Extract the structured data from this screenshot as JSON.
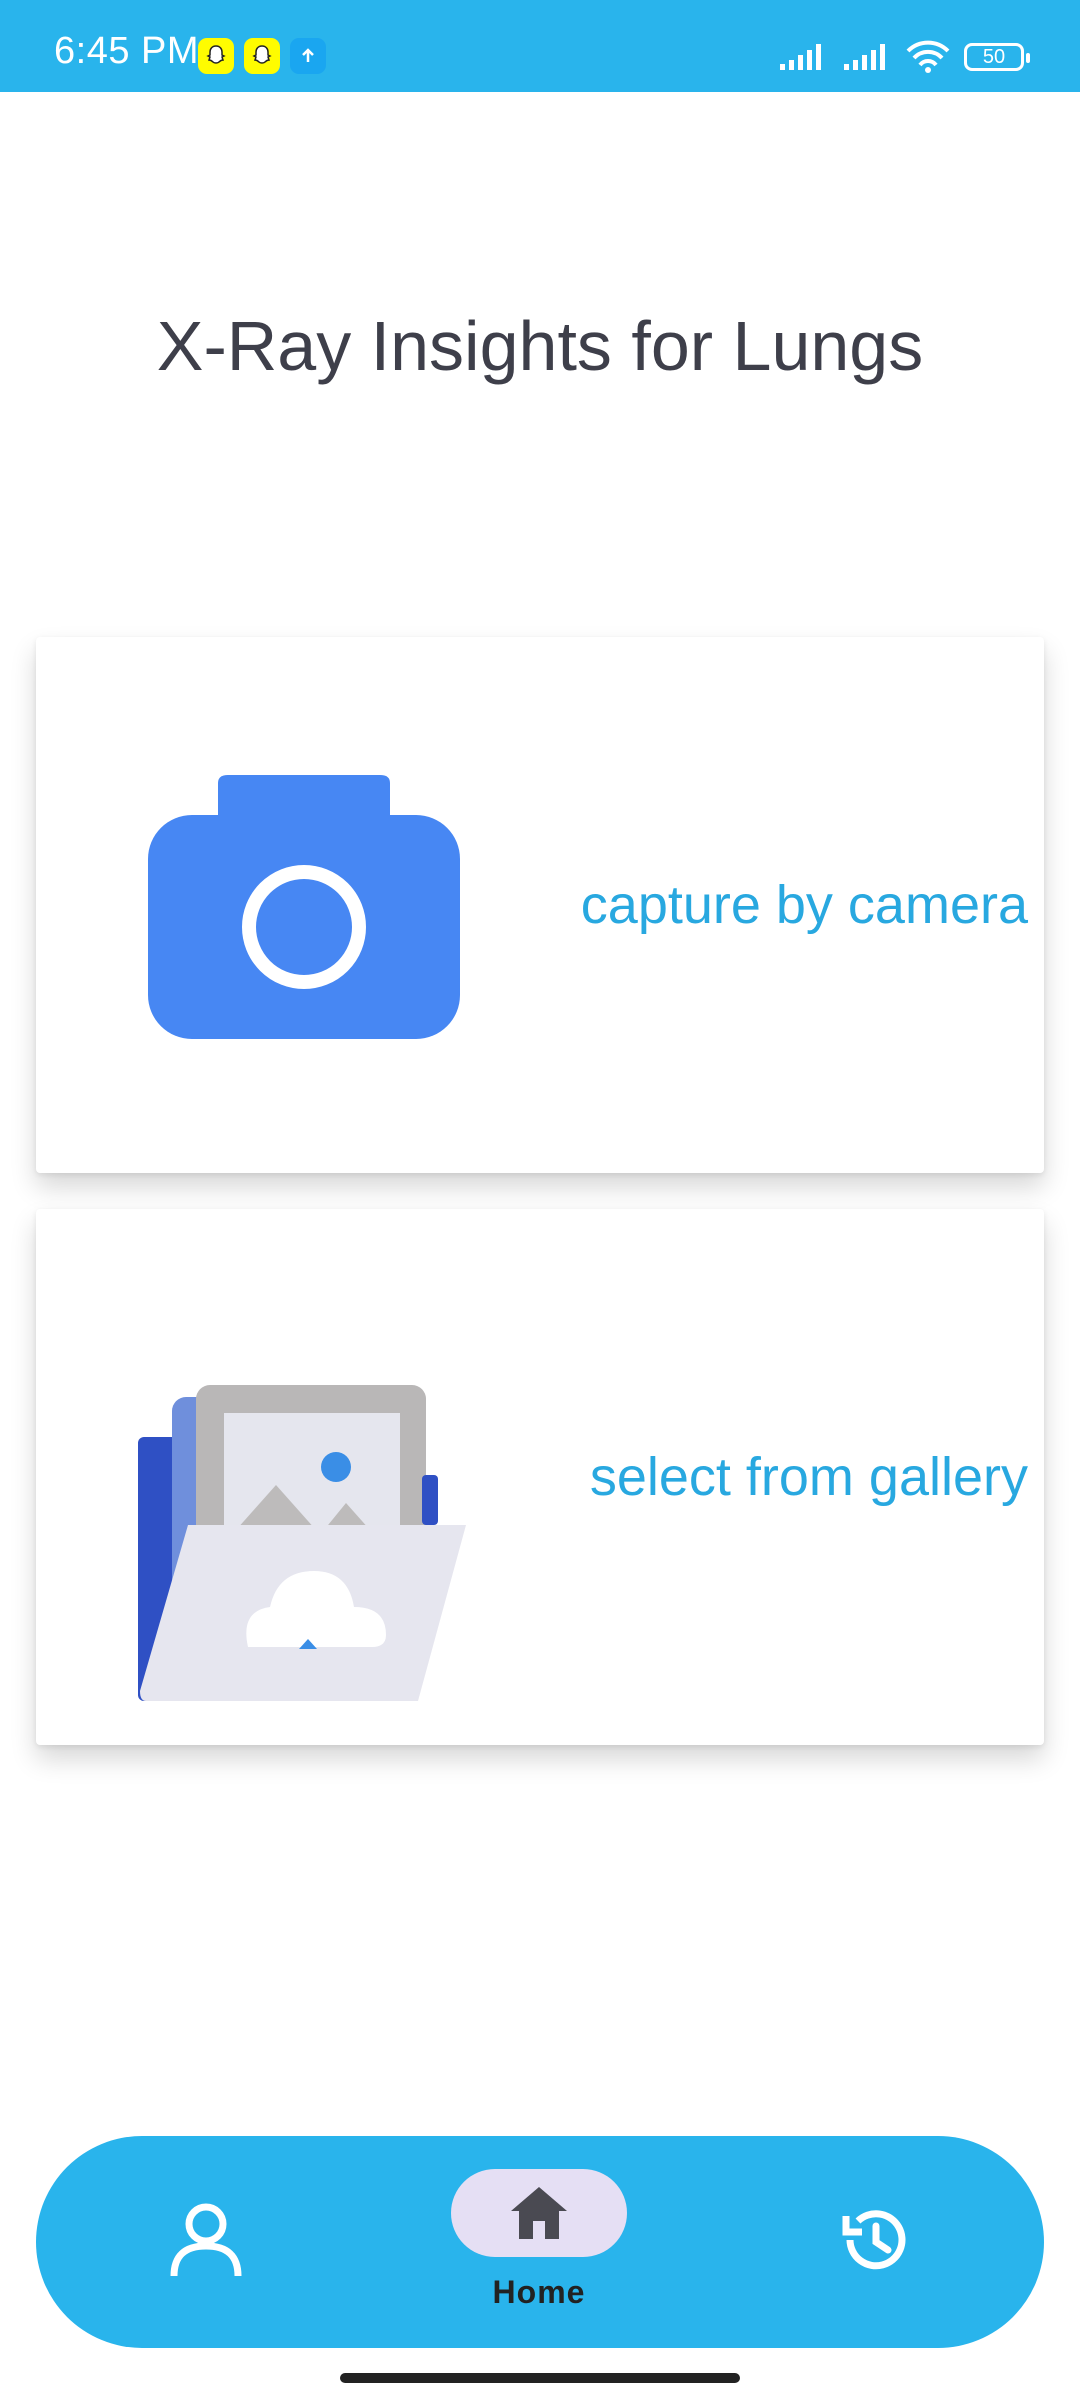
{
  "status_bar": {
    "time": "6:45 PM",
    "battery": "50",
    "color": "#29b4ec"
  },
  "title": "X-Ray Insights for Lungs",
  "cards": {
    "camera": {
      "label": "capture by camera",
      "icon": "camera-icon"
    },
    "gallery": {
      "label": "select from gallery",
      "icon": "gallery-folder-icon"
    }
  },
  "bottom_nav": {
    "items": [
      {
        "icon": "person-icon",
        "label": ""
      },
      {
        "icon": "home-icon",
        "label": "Home",
        "selected": true
      },
      {
        "icon": "history-icon",
        "label": ""
      }
    ]
  },
  "colors": {
    "accent": "#29b4ec",
    "label_blue": "#28a8e0",
    "camera_blue": "#4787f3",
    "title": "#3e3f4a"
  }
}
